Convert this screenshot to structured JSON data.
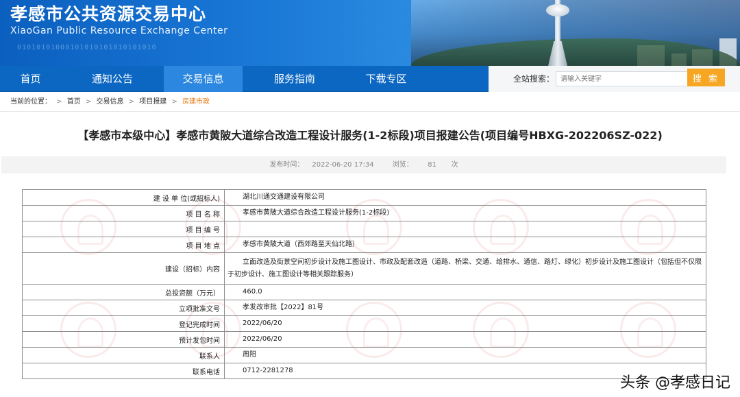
{
  "header": {
    "title_cn": "孝感市公共资源交易中心",
    "title_en": "XiaoGan Public Resource Exchange Center",
    "binary_text": "01010101000101010101010101010"
  },
  "nav": {
    "items": [
      "首页",
      "通知公告",
      "交易信息",
      "服务指南",
      "下载专区"
    ],
    "active_index": 2,
    "search_label": "全站搜索：",
    "search_placeholder": "请输入关键字",
    "search_button": "搜 索"
  },
  "breadcrumb": {
    "prefix": "当前的位置：",
    "items": [
      "首页",
      "交易信息",
      "项目报建",
      "房建市政"
    ],
    "separator": ">"
  },
  "article": {
    "title": "【孝感市本级中心】孝感市黄陂大道综合改造工程设计服务(1-2标段)项目报建公告(项目编号HBXG-202206SZ-022)",
    "publish_label": "发布时间：",
    "publish_time": "2022-06-20 17:34",
    "views_label": "浏览：",
    "views_count": "81",
    "views_unit": "次"
  },
  "table": {
    "rows": [
      {
        "label": "建 设 单 位(或招标人)",
        "value": "湖北川通交通建设有限公司"
      },
      {
        "label": "项 目 名 称",
        "value": "孝感市黄陂大道综合改造工程设计服务(1-2标段)"
      },
      {
        "label": "项 目 编 号",
        "value": ""
      },
      {
        "label": "项 目 地 点",
        "value": "孝感市黄陂大道（西郊路至天仙北路）"
      },
      {
        "label": "建设（招标）内容",
        "value": "立面改造及街景空间初步设计及施工图设计、市政及配套改造（道路、桥梁、交通、给排水、通信、路灯、绿化）初步设计及施工图设计（包括但不仅限于初步设计、施工图设计等相关跟踪服务）"
      },
      {
        "label": "总投资额（万元）",
        "value": "460.0"
      },
      {
        "label": "立项批准文号",
        "value": "孝发改审批【2022】81号"
      },
      {
        "label": "登记完成时间",
        "value": "2022/06/20"
      },
      {
        "label": "预计发包时间",
        "value": "2022/06/20"
      },
      {
        "label": "联系人",
        "value": "周阳"
      },
      {
        "label": "联系电话",
        "value": "0712-2281278"
      }
    ]
  },
  "footer": {
    "watermark": "头条 @孝感日记"
  },
  "colors": {
    "nav_bg": "#0b67c2",
    "nav_active": "#2b87df",
    "search_button": "#f6a623",
    "breadcrumb_current": "#e67d18"
  }
}
